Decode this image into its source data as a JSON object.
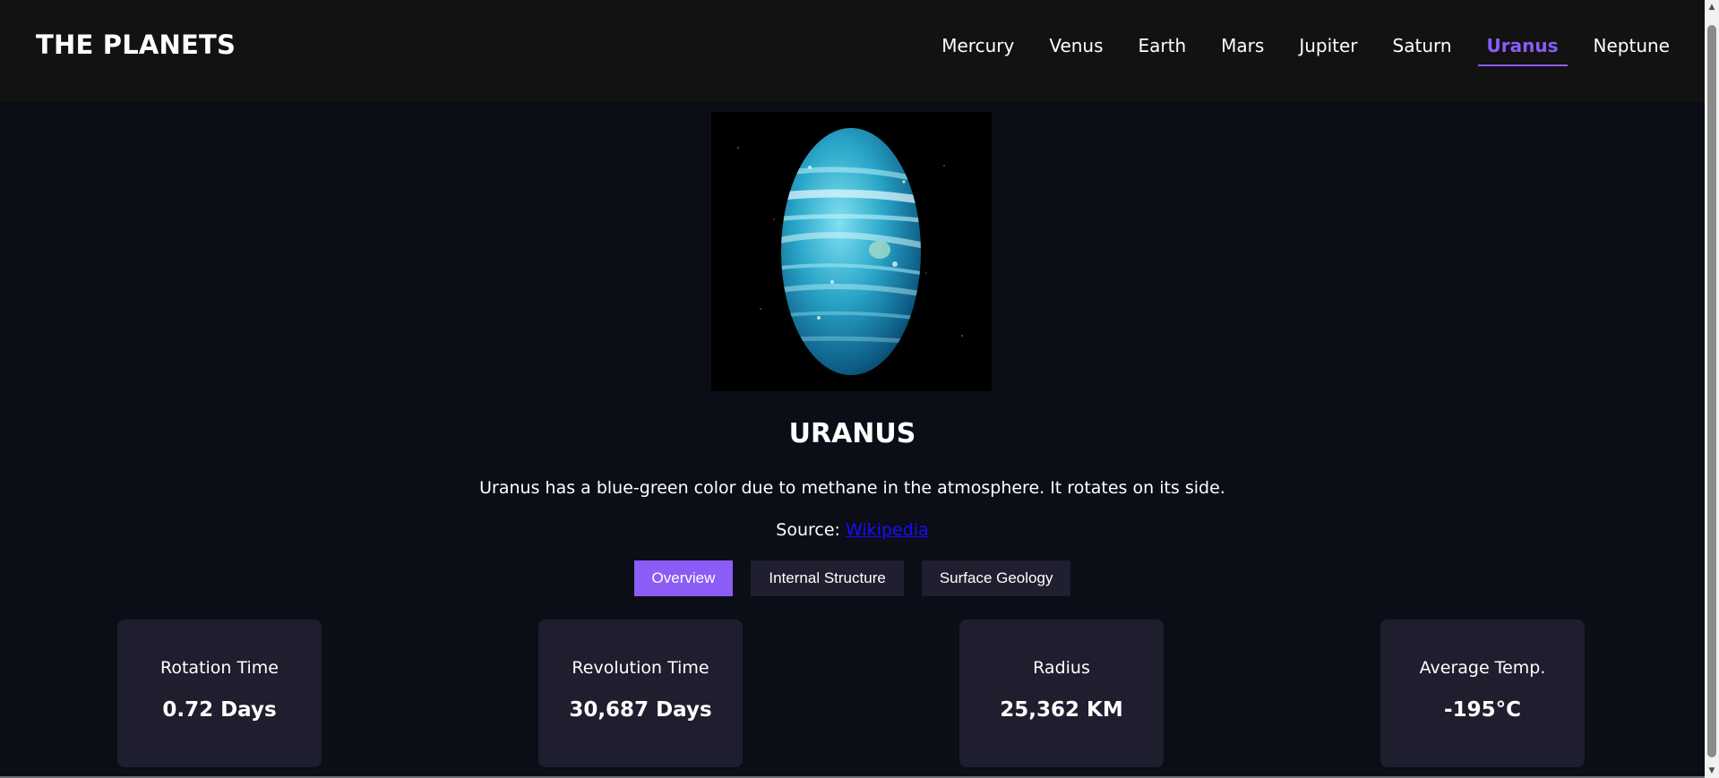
{
  "header": {
    "brand": "THE PLANETS",
    "nav": [
      "Mercury",
      "Venus",
      "Earth",
      "Mars",
      "Jupiter",
      "Saturn",
      "Uranus",
      "Neptune"
    ],
    "active": "Uranus",
    "accent_color": "#8b5cf6"
  },
  "planet": {
    "image_icon": "planet-uranus-illustration",
    "name": "URANUS",
    "description": "Uranus has a blue-green color due to methane in the atmosphere. It rotates on its side.",
    "source_label": "Source:",
    "source_link": "Wikipedia"
  },
  "tabs": {
    "items": [
      "Overview",
      "Internal Structure",
      "Surface Geology"
    ],
    "active": "Overview"
  },
  "stats": [
    {
      "label": "Rotation Time",
      "value": "0.72 Days"
    },
    {
      "label": "Revolution Time",
      "value": "30,687 Days"
    },
    {
      "label": "Radius",
      "value": "25,362 KM"
    },
    {
      "label": "Average Temp.",
      "value": "-195°C"
    }
  ],
  "scrollbar": {
    "up_icon": "triangle-up-icon",
    "down_icon": "triangle-down-icon"
  }
}
